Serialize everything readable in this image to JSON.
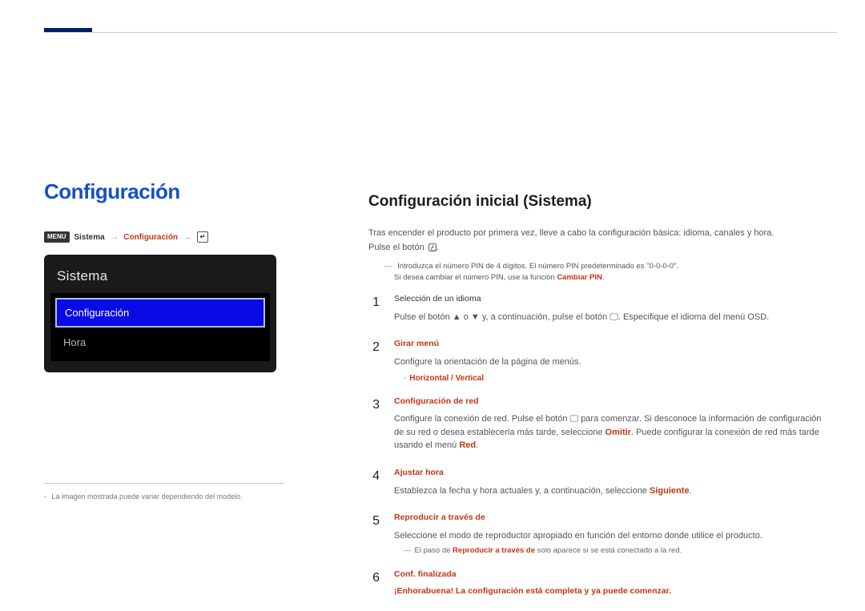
{
  "page": {
    "main_title": "Configuración",
    "path": {
      "menu_label": "MENU",
      "system": "Sistema",
      "config": "Configuración",
      "enter": "ENTER"
    },
    "panel": {
      "title": "Sistema",
      "items": [
        "Configuración",
        "Hora"
      ]
    },
    "caption": "La imagen mostrada puede variar dependiendo del modelo."
  },
  "right": {
    "title": "Configuración inicial (Sistema)",
    "intro_line1": "Tras encender el producto por primera vez, lleve a cabo la configuración básica: idioma, canales y hora.",
    "intro_line2_pre": "Pulse el botón",
    "pin_note1": "Introduzca el número PIN de 4 dígitos. El número PIN predeterminado es \"0-0-0-0\".",
    "pin_note2_pre": "Si desea cambiar el número PIN, use la función ",
    "pin_note2_red": "Cambiar PIN",
    "pin_note2_post": ".",
    "steps": [
      {
        "num": "1",
        "heading": "Selección de un idioma",
        "heading_style": "black",
        "body_lines": [
          {
            "text": "Pulse el botón ▲ o ▼ y, a continuación, pulse el botón 🖵. Especifique el idioma del menú OSD."
          }
        ]
      },
      {
        "num": "2",
        "heading": "Girar menú",
        "body_lines": [
          {
            "text": "Configure la orientación de la página de menús."
          }
        ],
        "sub": {
          "text": "Horizontal / Vertical",
          "red": true
        }
      },
      {
        "num": "3",
        "heading": "Configuración de red",
        "body_lines": [
          {
            "html": "Configure la conexión de red. Pulse el botón 🖵 para comenzar. Si desconoce la información de configuración de su red o desea establecerla más tarde, seleccione <span class=\"red\">Omitir</span>. Puede configurar la conexión de red más tarde usando el menú <span class=\"red\">Red</span>."
          }
        ]
      },
      {
        "num": "4",
        "heading": "Ajustar hora",
        "body_lines": [
          {
            "html": "Establezca la fecha y hora actuales y, a continuación, seleccione <span class=\"red\">Siguiente</span>."
          }
        ]
      },
      {
        "num": "5",
        "heading": "Reproducir a través de",
        "body_lines": [
          {
            "text": "Seleccione el modo de reproductor apropiado en función del entorno donde utilice el producto."
          }
        ],
        "note": {
          "pre": "El paso de ",
          "red": "Reproducir a través de",
          "post": " solo aparece si se está conectado a la red."
        }
      },
      {
        "num": "6",
        "heading": "Conf. finalizada",
        "final": "¡Enhorabuena! La configuración está completa y ya puede comenzar."
      }
    ]
  }
}
